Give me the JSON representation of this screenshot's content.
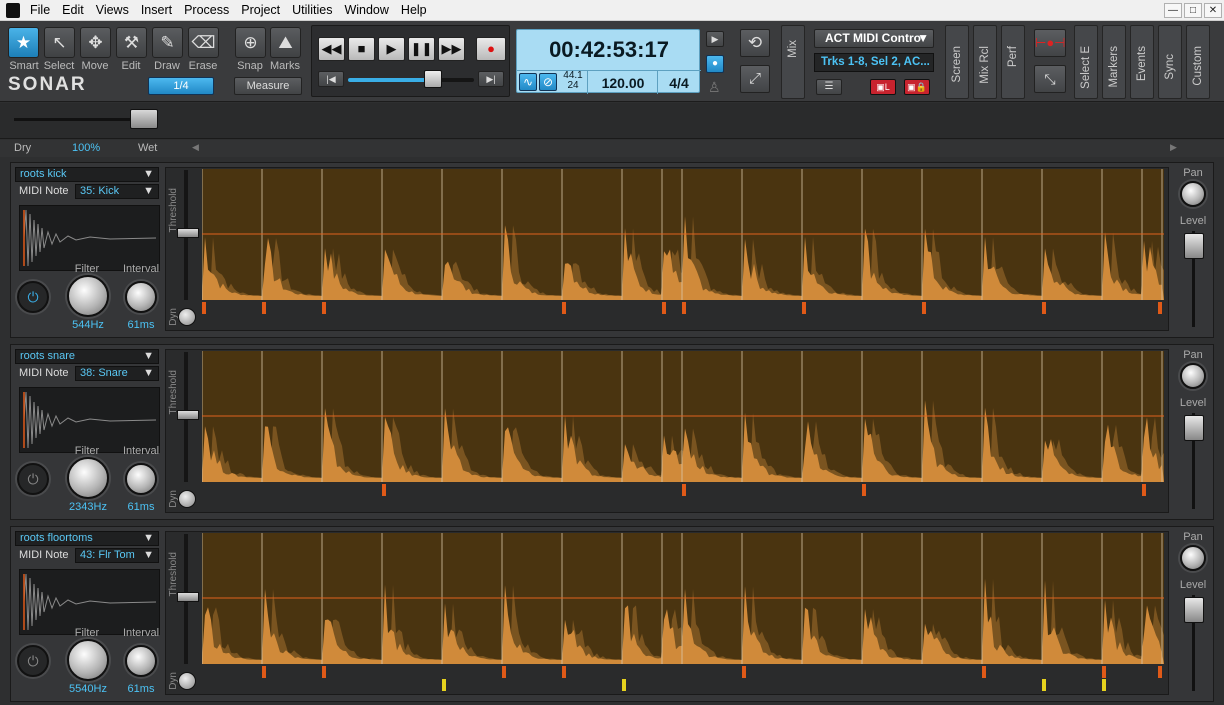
{
  "menu": [
    "File",
    "Edit",
    "Views",
    "Insert",
    "Process",
    "Project",
    "Utilities",
    "Window",
    "Help"
  ],
  "window_buttons": {
    "minimize": "—",
    "restore": "□",
    "close": "✕"
  },
  "tools": [
    {
      "label": "Smart",
      "glyph": "★"
    },
    {
      "label": "Select",
      "glyph": "↖"
    },
    {
      "label": "Move",
      "glyph": "✥"
    },
    {
      "label": "Edit",
      "glyph": "⚒"
    },
    {
      "label": "Draw",
      "glyph": "✎"
    },
    {
      "label": "Erase",
      "glyph": "⌫"
    }
  ],
  "app_logo": "SONAR",
  "snap_value": "1/4",
  "snap": {
    "snap_label": "Snap",
    "marks_label": "Marks",
    "measure_label": "Measure"
  },
  "transport": {
    "rewind": "◀◀",
    "stop": "■",
    "play": "▶",
    "pause": "❚❚",
    "ffwd": "▶▶",
    "record": "●",
    "go_start": "|◀",
    "go_end": "▶|"
  },
  "time": {
    "position": "00:42:53:17",
    "sample_rate_top": "44.1",
    "sample_rate_bottom": "24",
    "tempo": "120.00",
    "meter": "4/4"
  },
  "mix_label": "Mix",
  "control_surface": {
    "name": "ACT MIDI Contro",
    "track_info": "Trks 1-8, Sel 2, AC..."
  },
  "view_tabs": [
    "Screen",
    "Mix Rcl",
    "Perf",
    "Select E",
    "Markers",
    "Events",
    "Sync",
    "Custom"
  ],
  "dry_wet": {
    "dry": "Dry",
    "value": "100%",
    "wet": "Wet"
  },
  "side_labels": {
    "threshold": "Threshold",
    "dyn": "Dyn",
    "pan": "Pan",
    "level": "Level",
    "filter": "Filter",
    "interval": "Interval"
  },
  "lanes": [
    {
      "track": "roots kick",
      "note_label": "MIDI Note",
      "note": "35: Kick",
      "filter": "544Hz",
      "interval": "61ms",
      "power_on": true,
      "markers_orange": [
        0,
        60,
        120,
        360,
        460,
        480,
        600,
        720,
        840,
        960
      ],
      "markers_yellow": []
    },
    {
      "track": "roots snare",
      "note_label": "MIDI Note",
      "note": "38: Snare",
      "filter": "2343Hz",
      "interval": "61ms",
      "power_on": false,
      "markers_orange": [
        180,
        480,
        660,
        940
      ],
      "markers_yellow": []
    },
    {
      "track": "roots floortoms",
      "note_label": "MIDI Note",
      "note": "43: Flr Tom",
      "filter": "5540Hz",
      "interval": "61ms",
      "power_on": false,
      "markers_orange": [
        60,
        120,
        300,
        360,
        540,
        780,
        900,
        960
      ],
      "markers_yellow": [
        240,
        420,
        840,
        900
      ]
    }
  ],
  "colors": {
    "accent": "#3aaee6",
    "wave_fill": "#d08a3a",
    "wave_bg": "#4a3410",
    "threshold": "#e0621e",
    "marker_orange": "#e05a18",
    "marker_yellow": "#e6d21e"
  }
}
